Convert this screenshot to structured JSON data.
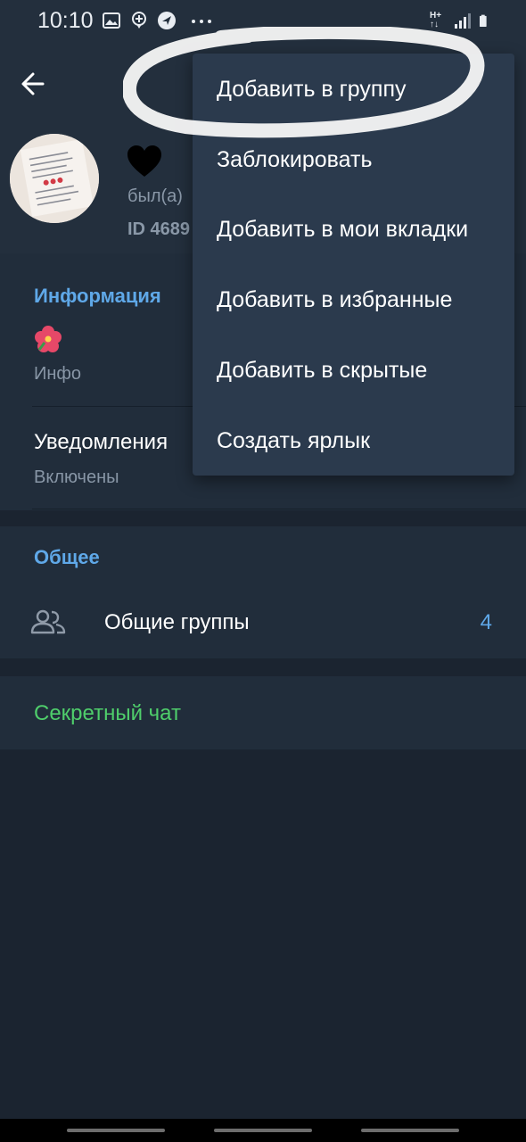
{
  "status": {
    "time": "10:10",
    "icons_left": [
      "image-icon",
      "location-pin-icon",
      "compass-icon",
      "more-dots-icon"
    ],
    "icons_right": [
      "hplus-network-icon",
      "signal-icon",
      "battery-icon"
    ],
    "network_label": "H+"
  },
  "profile": {
    "name_emoji": "black-heart",
    "last_seen": "был(а)",
    "user_id": "ID 4689"
  },
  "menu": {
    "items": [
      "Добавить в группу",
      "Заблокировать",
      "Добавить в мои вкладки",
      "Добавить в избранные",
      "Добавить в скрытые",
      "Создать ярлык"
    ]
  },
  "info_section": {
    "title": "Информация",
    "bio_emoji": "hibiscus",
    "bio_caption": "Инфо",
    "notifications_label": "Уведомления",
    "notifications_value": "Включены"
  },
  "common_section": {
    "title": "Общее",
    "groups_label": "Общие группы",
    "groups_count": "4"
  },
  "secret_chat": {
    "label": "Секретный чат"
  },
  "colors": {
    "background": "#1b2430",
    "header": "#232f3d",
    "card": "#212d3b",
    "menu": "#2b3a4d",
    "accent_blue": "#5fa8e8",
    "accent_green": "#4fce6b"
  }
}
